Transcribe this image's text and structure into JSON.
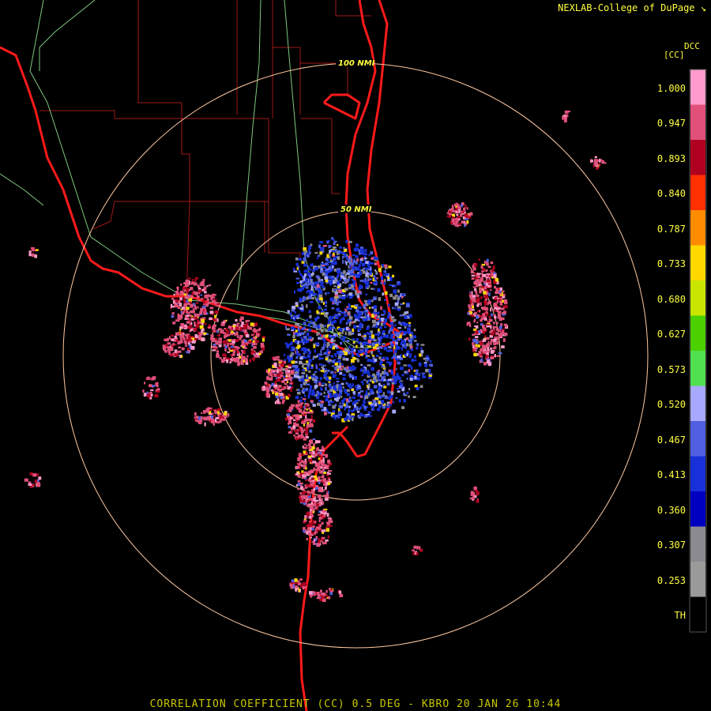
{
  "credit": "NEXLAB-College of DuPage",
  "product_title": "CORRELATION COEFFICIENT (CC) 0.5 DEG - KBRO 20 JAN 26 10:44",
  "legend": {
    "product_code": "DCC",
    "unit": "[CC]",
    "labels": [
      "1.000",
      "0.947",
      "0.893",
      "0.840",
      "0.787",
      "0.733",
      "0.680",
      "0.627",
      "0.573",
      "0.520",
      "0.467",
      "0.413",
      "0.360",
      "0.307",
      "0.253",
      "TH"
    ],
    "colors": [
      "#ff9ccc",
      "#e0507a",
      "#b00020",
      "#ff3000",
      "#ff8c00",
      "#ffd800",
      "#c8e600",
      "#4bd000",
      "#50e050",
      "#a8a8ff",
      "#5060e0",
      "#1830d8",
      "#0000c0",
      "#8a8a90",
      "#9a9a9a",
      "#000000"
    ]
  },
  "range_rings": [
    "50 NMI",
    "100 NMI"
  ],
  "colors": {
    "background": "#000000",
    "coastline": "#ff1a1a",
    "county_lines": "#a01818",
    "highways": "#90ee90",
    "range_ring": "#ffc8a0"
  }
}
